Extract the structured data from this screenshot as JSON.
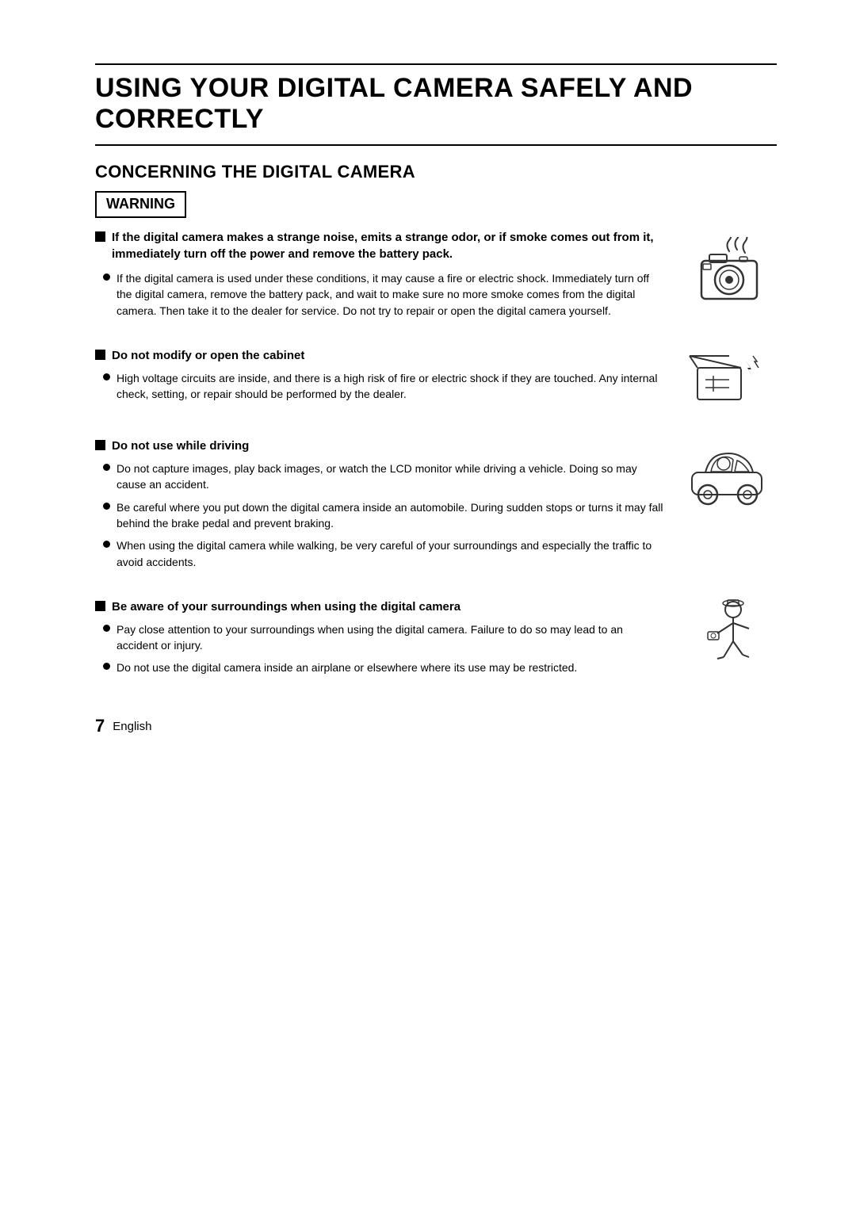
{
  "page": {
    "title": "USING YOUR DIGITAL CAMERA SAFELY AND CORRECTLY",
    "section": "CONCERNING THE DIGITAL CAMERA",
    "warning_label": "WARNING",
    "warning_main_bullet": "If the digital camera makes a strange noise, emits a strange odor, or if smoke comes out from it, immediately turn off the power and remove the battery pack.",
    "warning_sub_bullet": "If the digital camera is used under these conditions, it may cause a fire or electric shock. Immediately turn off the digital camera, remove the battery pack, and wait to make sure no more smoke comes from the digital camera. Then take it to the dealer for service. Do not try to repair or open the digital camera yourself.",
    "cabinet_header": "Do not modify or open the cabinet",
    "cabinet_bullet": "High voltage circuits are inside, and there is a high risk of fire or electric shock if they are touched. Any internal check, setting, or repair should be performed by the dealer.",
    "driving_header": "Do not use while driving",
    "driving_bullet1": "Do not capture images, play back images, or watch the LCD monitor while driving a vehicle. Doing so may cause an accident.",
    "driving_bullet2": "Be careful where you put down the digital camera inside an automobile. During sudden stops or turns it may fall behind the brake pedal and prevent braking.",
    "driving_bullet3": "When using the digital camera while walking, be very careful of your surroundings and especially the traffic to avoid accidents.",
    "surroundings_header": "Be aware of your surroundings when using the digital camera",
    "surroundings_bullet1": "Pay close attention to your surroundings when using the digital camera. Failure to do so may lead to an accident or injury.",
    "surroundings_bullet2": "Do not use the digital camera inside an airplane or elsewhere where its use may be restricted.",
    "page_number": "7",
    "language": "English"
  }
}
